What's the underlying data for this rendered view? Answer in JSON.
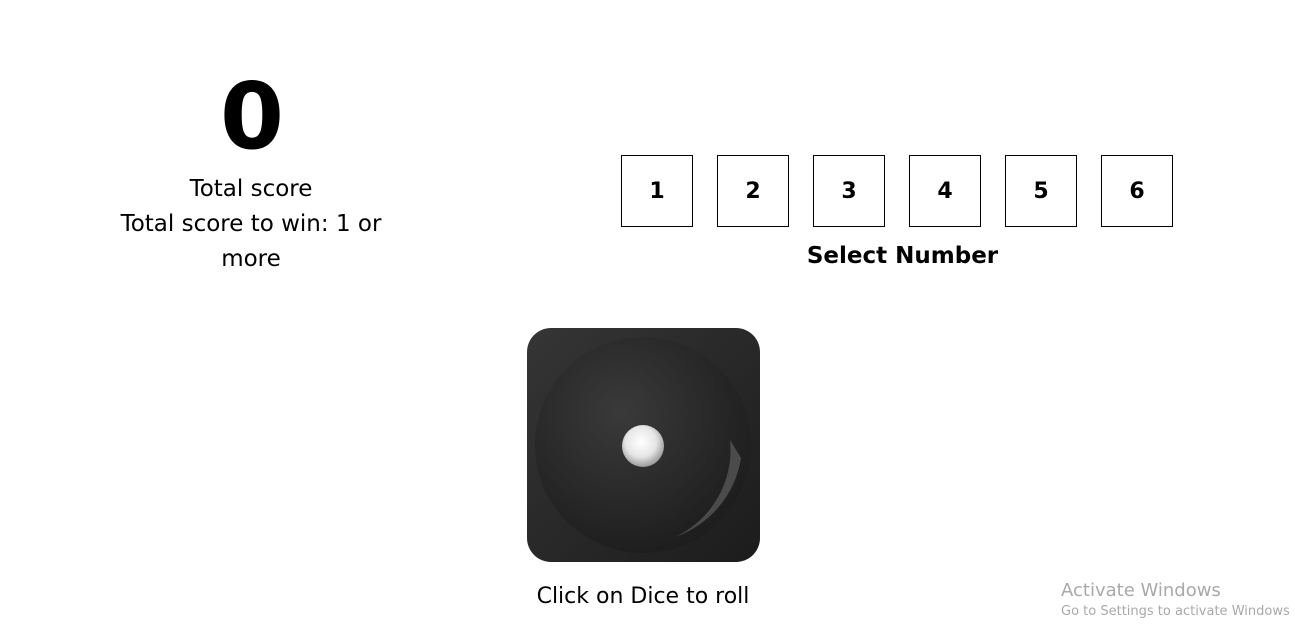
{
  "score": {
    "value": "0",
    "label": "Total score",
    "target_text": "Total score to win: 1 or more"
  },
  "number_selector": {
    "numbers": [
      "1",
      "2",
      "3",
      "4",
      "5",
      "6"
    ],
    "label": "Select Number"
  },
  "dice": {
    "face_value": 1,
    "icon": "dice-one-icon",
    "hint": "Click on Dice to roll"
  },
  "watermark": {
    "title": "Activate Windows",
    "subtitle": "Go to Settings to activate Windows"
  }
}
